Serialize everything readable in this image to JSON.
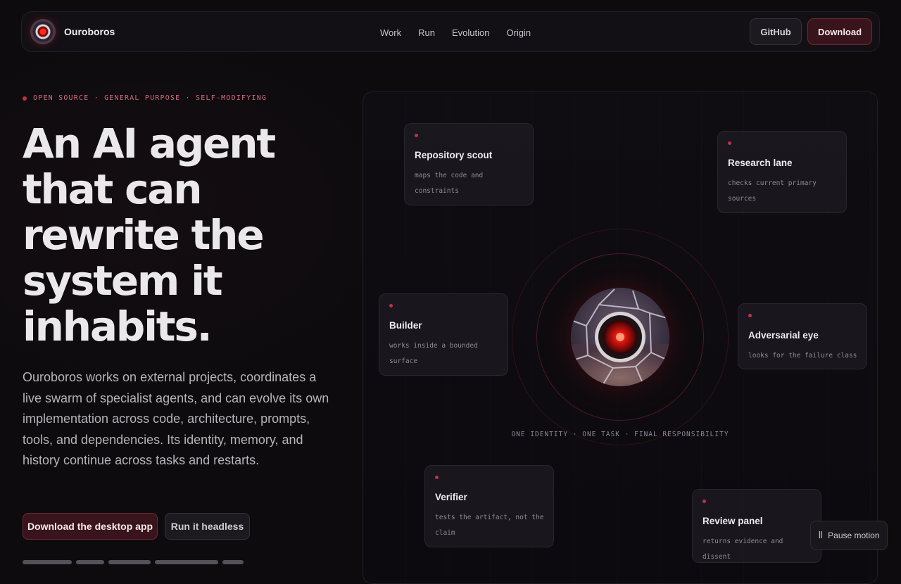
{
  "brand": {
    "name": "Ouroboros",
    "logo_icon": "red-eye-icon"
  },
  "nav": {
    "links": [
      "Work",
      "Run",
      "Evolution",
      "Origin"
    ],
    "github_label": "GitHub",
    "download_label": "Download"
  },
  "hero": {
    "eyebrow": "OPEN SOURCE · GENERAL PURPOSE · SELF-MODIFYING",
    "headline": "An AI agent that can rewrite the system it inhabits.",
    "lead": "Ouroboros works on external projects, coordinates a live swarm of specialist agents, and can evolve its own implementation across code, architecture, prompts, tools, and dependencies. Its identity, memory, and history continue across tasks and restarts.",
    "primary_cta": "Download the desktop app",
    "secondary_cta": "Run it headless"
  },
  "stage": {
    "core_caption": "ONE IDENTITY · ONE TASK · FINAL RESPONSIBILITY",
    "agents": [
      {
        "title": "Repository scout",
        "body": "maps the code and constraints"
      },
      {
        "title": "Research lane",
        "body": "checks current primary sources"
      },
      {
        "title": "Builder",
        "body": "works inside a bounded surface"
      },
      {
        "title": "Adversarial eye",
        "body": "looks for the failure class"
      },
      {
        "title": "Verifier",
        "body": "tests the artifact, not the claim"
      },
      {
        "title": "Review panel",
        "body": "returns evidence and dissent"
      }
    ]
  },
  "controls": {
    "pause_label": "Pause motion",
    "pause_icon": "pause-icon"
  },
  "colors": {
    "accent": "#c2304a",
    "button_dark_red": "#3a141c",
    "background": "#0d0b0e"
  }
}
